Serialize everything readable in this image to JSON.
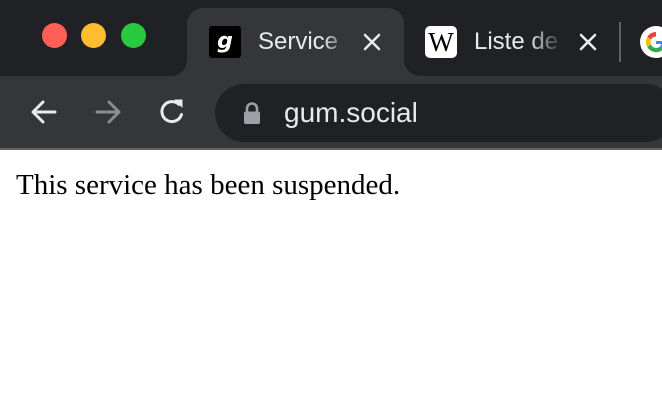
{
  "window": {
    "traffic_lights": [
      "close",
      "minimize",
      "maximize"
    ],
    "colors": {
      "close": "#ff5f57",
      "minimize": "#febc2e",
      "maximize": "#28c840",
      "frame": "#202124",
      "toolbar": "#35363a"
    }
  },
  "tabs": [
    {
      "title": "Service",
      "favicon": "gum-logo-icon",
      "favicon_glyph": "g",
      "active": true
    },
    {
      "title": "Liste de",
      "favicon": "wikipedia-icon",
      "favicon_glyph": "W",
      "active": false
    },
    {
      "title": "",
      "favicon": "google-icon",
      "active": false
    }
  ],
  "toolbar": {
    "back_icon": "arrow-left-icon",
    "forward_icon": "arrow-right-icon",
    "reload_icon": "reload-icon",
    "forward_enabled": false
  },
  "omnibox": {
    "security_icon": "lock-icon",
    "url": "gum.social"
  },
  "page": {
    "message": "This service has been suspended."
  }
}
